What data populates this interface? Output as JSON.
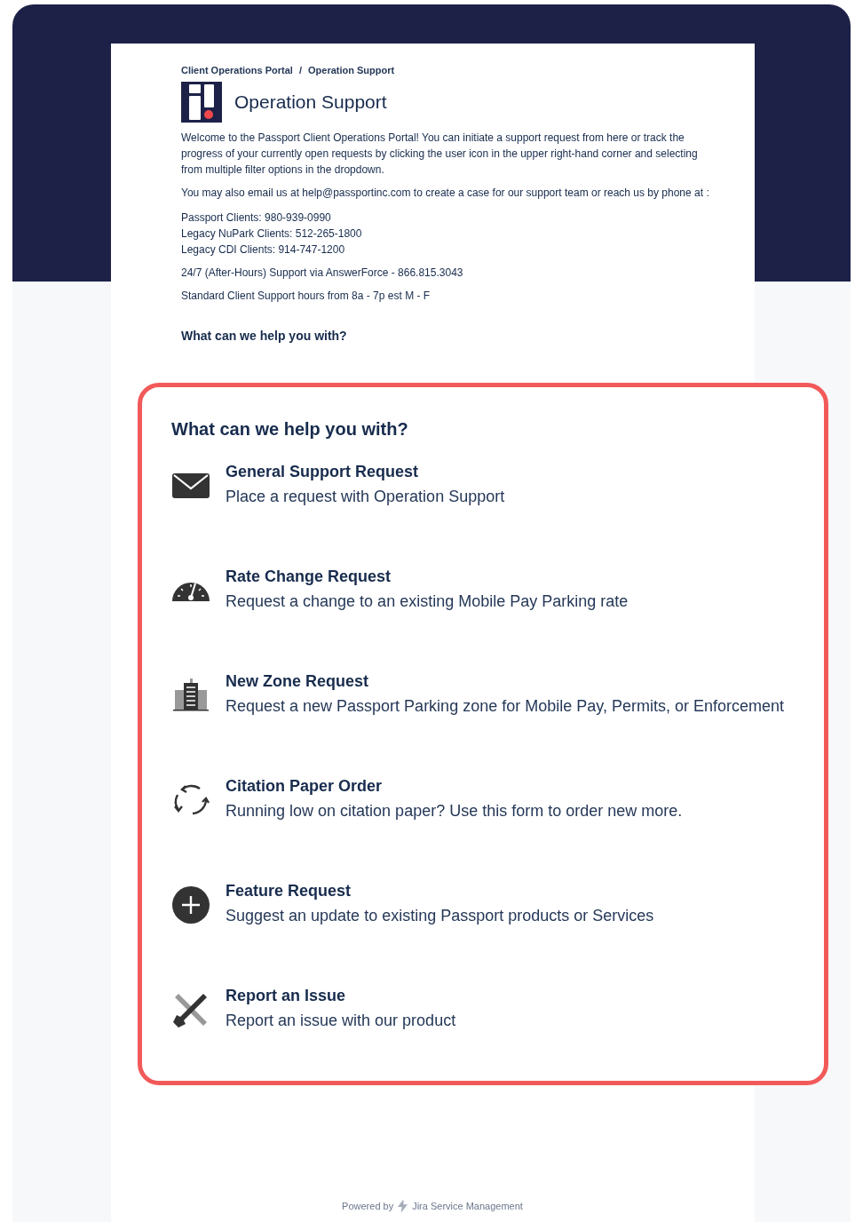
{
  "breadcrumbs": [
    {
      "label": "Client Operations Portal"
    },
    {
      "label": "Operation Support"
    }
  ],
  "breadcrumb_separator": "/",
  "title": "Operation Support",
  "intro": [
    "Welcome to the Passport Client Operations Portal! You can initiate a support request from here or track the progress of your currently open requests by clicking the user icon in the upper right-hand corner and selecting from multiple filter options in the dropdown.",
    "You may also email us at help@passportinc.com to create a case for our support team or reach us by phone at :"
  ],
  "phones": [
    "Passport Clients: 980-939-0990",
    "Legacy NuPark Clients: 512-265-1800",
    "Legacy CDI Clients: 914-747-1200"
  ],
  "after_hours": "24/7 (After-Hours) Support via AnswerForce - 866.815.3043",
  "hours": "Standard Client Support hours from 8a - 7p est M - F",
  "help_heading": "What can we help you with?",
  "popup": {
    "heading": "What can we help you with?",
    "items": [
      {
        "kind": "mail",
        "title": "General Support Request",
        "description": "Place a request with Operation Support"
      },
      {
        "kind": "gauge",
        "title": "Rate Change Request",
        "description": "Request a change to an existing Mobile Pay Parking rate"
      },
      {
        "kind": "building",
        "title": "New Zone Request",
        "description": "Request a new Passport Parking zone for Mobile Pay, Permits, or Enforcement"
      },
      {
        "kind": "cycle",
        "title": "Citation Paper Order",
        "description": "Running low on citation paper? Use this form to order new more."
      },
      {
        "kind": "plus",
        "title": "Feature Request",
        "description": "Suggest an update to existing Passport products or Services"
      },
      {
        "kind": "tools",
        "title": "Report an Issue",
        "description": "Report an issue with our product"
      }
    ]
  },
  "footer": {
    "powered_by": "Powered by",
    "product": "Jira Service Management"
  }
}
